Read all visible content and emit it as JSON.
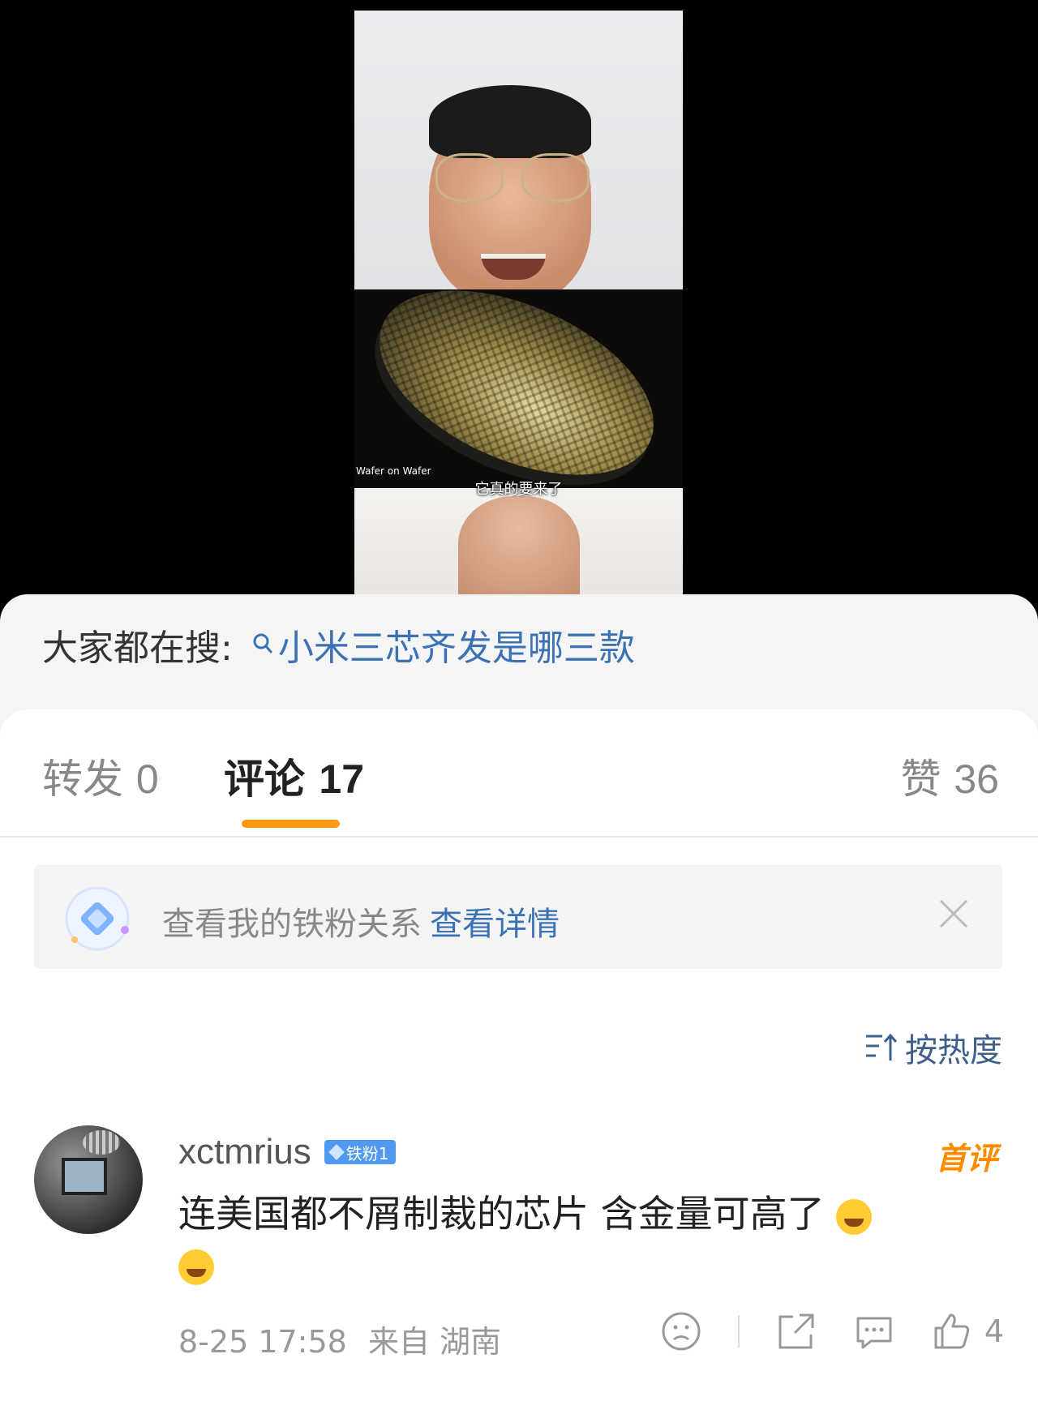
{
  "video": {
    "subtitle": "它真的要来了",
    "wafer_caption": "Wafer on Wafer",
    "wafer_caption_small": "",
    "watermark": ""
  },
  "search": {
    "label": "大家都在搜:",
    "query": "小米三芯齐发是哪三款"
  },
  "tabs": {
    "repost_label": "转发",
    "repost_count": "0",
    "comments_label": "评论",
    "comments_count": "17",
    "likes_label": "赞",
    "likes_count": "36"
  },
  "fan_banner": {
    "text": "查看我的铁粉关系",
    "link": "查看详情"
  },
  "sort": {
    "label": "按热度"
  },
  "comments": [
    {
      "username": "xctmrius",
      "badge": "铁粉1",
      "tag": "首评",
      "text": "连美国都不屑制裁的芯片 含金量可高了",
      "time": "8-25 17:58",
      "location": "来自 湖南",
      "likes": "4"
    }
  ],
  "colors": {
    "accent": "#ff9a0f",
    "link": "#3b72b4",
    "sort": "#3e5f89",
    "badge": "#4f9af0",
    "first_tag": "#ff8a00"
  }
}
